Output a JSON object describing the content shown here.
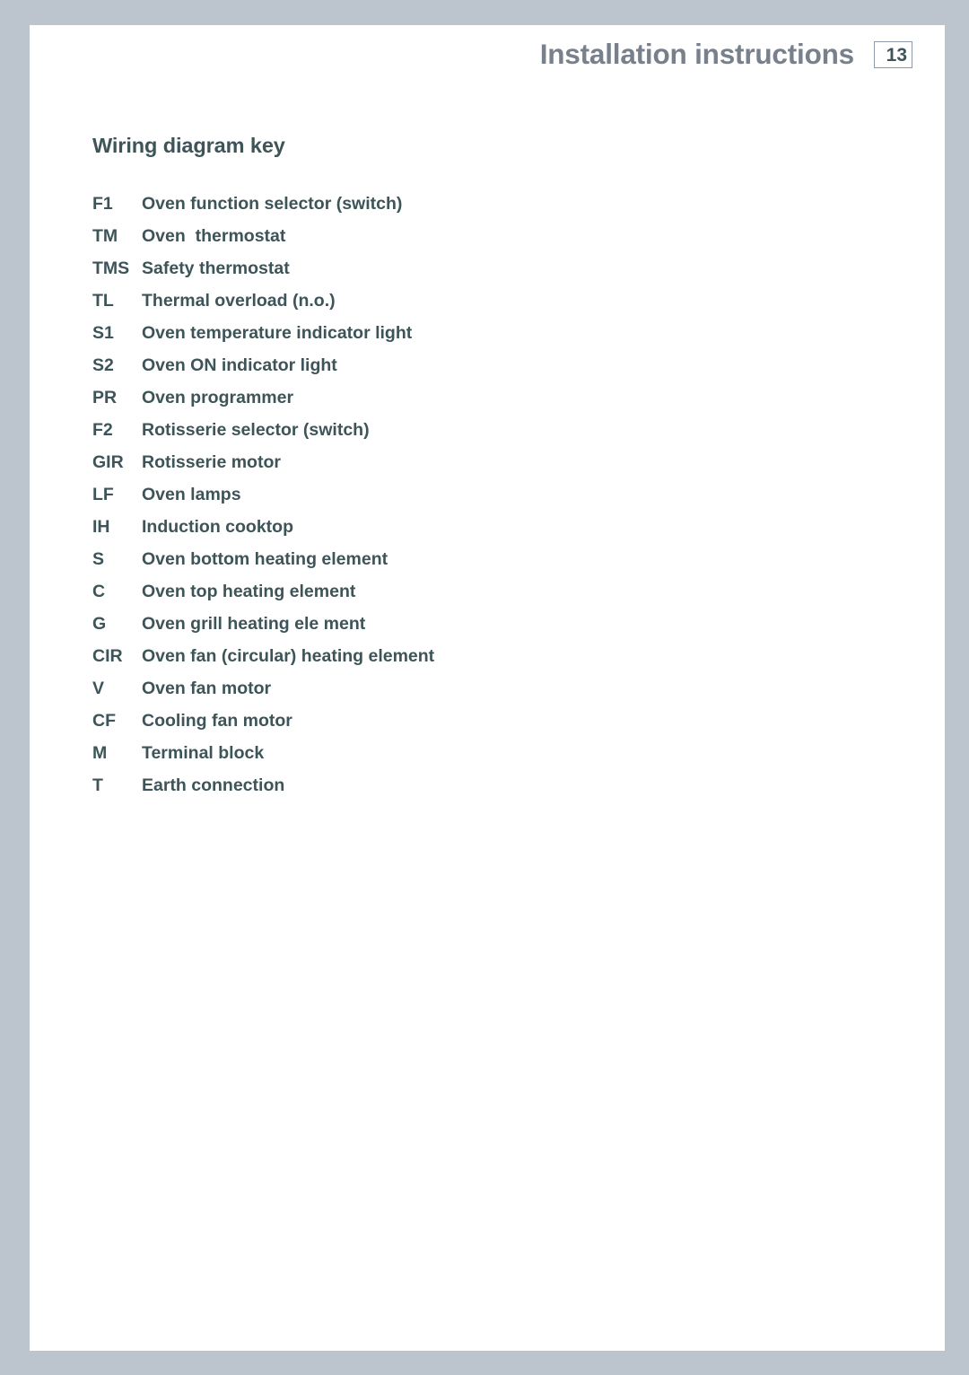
{
  "header": {
    "title": "Installation instructions",
    "page_number": "13"
  },
  "section": {
    "heading": "Wiring diagram key"
  },
  "wiring_key": [
    {
      "code": "F1",
      "description": "Oven function selector (switch)"
    },
    {
      "code": "TM",
      "description": "Oven  thermostat"
    },
    {
      "code": "TMS",
      "description": "Safety thermostat"
    },
    {
      "code": "TL",
      "description": "Thermal overload (n.o.)"
    },
    {
      "code": "S1",
      "description": "Oven temperature indicator light"
    },
    {
      "code": "S2",
      "description": "Oven ON indicator light"
    },
    {
      "code": "PR",
      "description": "Oven programmer"
    },
    {
      "code": "F2",
      "description": "Rotisserie selector (switch)"
    },
    {
      "code": "GIR",
      "description": "Rotisserie motor"
    },
    {
      "code": "LF",
      "description": "Oven lamps"
    },
    {
      "code": "IH",
      "description": "Induction cooktop"
    },
    {
      "code": "S",
      "description": "Oven bottom heating element"
    },
    {
      "code": "C",
      "description": "Oven top heating element"
    },
    {
      "code": "G",
      "description": "Oven grill heating ele ment"
    },
    {
      "code": "CIR",
      "description": "Oven fan (circular) heating element"
    },
    {
      "code": "V",
      "description": "Oven fan motor"
    },
    {
      "code": "CF",
      "description": "Cooling fan motor"
    },
    {
      "code": "M",
      "description": "Terminal block"
    },
    {
      "code": "T",
      "description": "Earth connection"
    }
  ],
  "colors": {
    "frame_background": "#bcc5ce",
    "page_background": "#ffffff",
    "header_title": "#78808c",
    "body_text": "#3d5459",
    "page_number_border": "#8e98a6"
  }
}
